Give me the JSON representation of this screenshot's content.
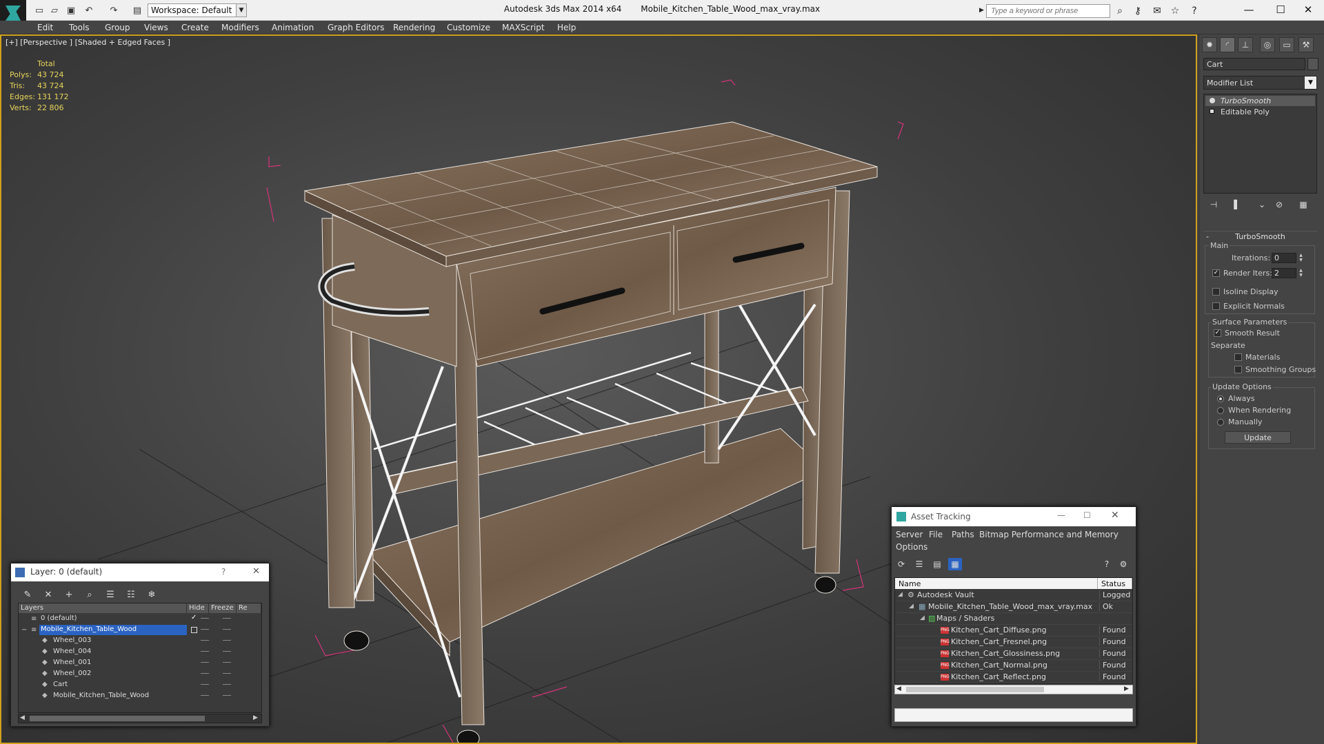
{
  "window": {
    "app_title": "Autodesk 3ds Max  2014 x64",
    "file_name": "Mobile_Kitchen_Table_Wood_max_vray.max",
    "workspace": "Workspace: Default",
    "search_placeholder": "Type a keyword or phrase"
  },
  "menu": [
    "Edit",
    "Tools",
    "Group",
    "Views",
    "Create",
    "Modifiers",
    "Animation",
    "Graph Editors",
    "Rendering",
    "Customize",
    "MAXScript",
    "Help"
  ],
  "viewport": {
    "label": "[+] [Perspective ] [Shaded + Edged Faces ]",
    "stats_header": "Total",
    "stats": [
      {
        "label": "Polys:",
        "value": "43 724"
      },
      {
        "label": "Tris:",
        "value": "43 724"
      },
      {
        "label": "Edges:",
        "value": "131 172"
      },
      {
        "label": "Verts:",
        "value": "22 806"
      }
    ]
  },
  "command_panel": {
    "object_name": "Cart",
    "modifier_list": "Modifier List",
    "stack": [
      "TurboSmooth",
      "Editable Poly"
    ],
    "turbosmooth": {
      "title": "TurboSmooth",
      "main": "Main",
      "iterations_label": "Iterations:",
      "iterations": "0",
      "render_iters_label": "Render Iters:",
      "render_iters": "2",
      "isoline": "Isoline Display",
      "explicit_normals": "Explicit Normals",
      "surface_params": "Surface Parameters",
      "smooth_result": "Smooth Result",
      "separate": "Separate",
      "materials": "Materials",
      "smoothing_groups": "Smoothing Groups",
      "update_options": "Update Options",
      "always": "Always",
      "when_rendering": "When Rendering",
      "manually": "Manually",
      "update_button": "Update"
    }
  },
  "layer_dialog": {
    "title": "Layer: 0 (default)",
    "help": "?",
    "columns": [
      "Layers",
      "Hide",
      "Freeze",
      "Re"
    ],
    "rows": [
      "0 (default)",
      "Mobile_Kitchen_Table_Wood",
      "Wheel_003",
      "Wheel_004",
      "Wheel_001",
      "Wheel_002",
      "Cart",
      "Mobile_Kitchen_Table_Wood"
    ]
  },
  "asset_dialog": {
    "title": "Asset Tracking",
    "menu": [
      "Server",
      "File",
      "Paths",
      "Bitmap Performance and Memory",
      "Options"
    ],
    "columns": [
      "Name",
      "Status"
    ],
    "rows": [
      {
        "name": "Autodesk Vault",
        "status": "Logged O"
      },
      {
        "name": "Mobile_Kitchen_Table_Wood_max_vray.max",
        "status": "Ok"
      },
      {
        "name": "Maps / Shaders",
        "status": ""
      },
      {
        "name": "Kitchen_Cart_Diffuse.png",
        "status": "Found"
      },
      {
        "name": "Kitchen_Cart_Fresnel.png",
        "status": "Found"
      },
      {
        "name": "Kitchen_Cart_Glossiness.png",
        "status": "Found"
      },
      {
        "name": "Kitchen_Cart_Normal.png",
        "status": "Found"
      },
      {
        "name": "Kitchen_Cart_Reflect.png",
        "status": "Found"
      }
    ],
    "png_badge": "PNG"
  },
  "colors": {
    "viewport_border": "#cfa11e",
    "stats_text": "#e8d45a",
    "selection": "#2a63c2",
    "bbox": "#d6337a"
  }
}
